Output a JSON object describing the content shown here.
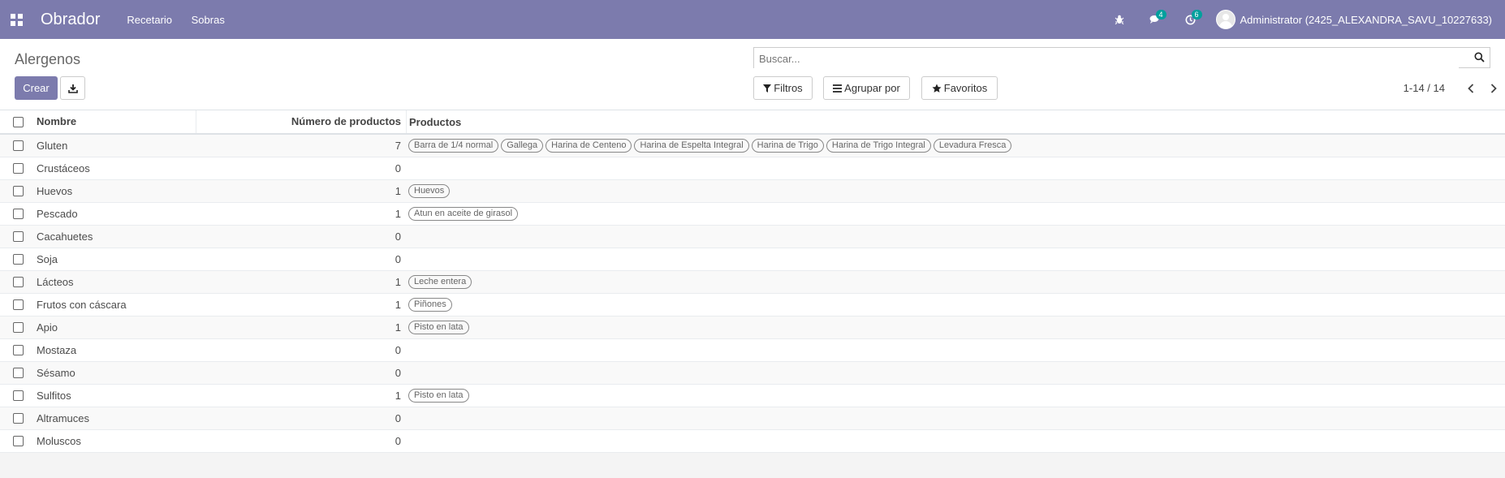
{
  "navbar": {
    "brand": "Obrador",
    "menu": [
      "Recetario",
      "Sobras"
    ],
    "messages_count": "4",
    "activities_count": "6",
    "user": "Administrator (2425_ALEXANDRA_SAVU_10227633)",
    "color": "#7c7bad"
  },
  "control": {
    "title": "Alergenos",
    "create_label": "Crear",
    "search_placeholder": "Buscar...",
    "filters_label": "Filtros",
    "groupby_label": "Agrupar por",
    "favorites_label": "Favoritos",
    "pager": "1-14 / 14"
  },
  "table": {
    "headers": {
      "name": "Nombre",
      "count": "Número de productos",
      "products": "Productos"
    },
    "rows": [
      {
        "name": "Gluten",
        "count": "7",
        "products": [
          "Barra de 1/4 normal",
          "Gallega",
          "Harina de Centeno",
          "Harina de Espelta Integral",
          "Harina de Trigo",
          "Harina de Trigo Integral",
          "Levadura Fresca"
        ]
      },
      {
        "name": "Crustáceos",
        "count": "0",
        "products": []
      },
      {
        "name": "Huevos",
        "count": "1",
        "products": [
          "Huevos"
        ]
      },
      {
        "name": "Pescado",
        "count": "1",
        "products": [
          "Atun en aceite de girasol"
        ]
      },
      {
        "name": "Cacahuetes",
        "count": "0",
        "products": []
      },
      {
        "name": "Soja",
        "count": "0",
        "products": []
      },
      {
        "name": "Lácteos",
        "count": "1",
        "products": [
          "Leche entera"
        ]
      },
      {
        "name": "Frutos con cáscara",
        "count": "1",
        "products": [
          "Piñones"
        ]
      },
      {
        "name": "Apio",
        "count": "1",
        "products": [
          "Pisto en lata"
        ]
      },
      {
        "name": "Mostaza",
        "count": "0",
        "products": []
      },
      {
        "name": "Sésamo",
        "count": "0",
        "products": []
      },
      {
        "name": "Sulfitos",
        "count": "1",
        "products": [
          "Pisto en lata"
        ]
      },
      {
        "name": "Altramuces",
        "count": "0",
        "products": []
      },
      {
        "name": "Moluscos",
        "count": "0",
        "products": []
      }
    ]
  }
}
